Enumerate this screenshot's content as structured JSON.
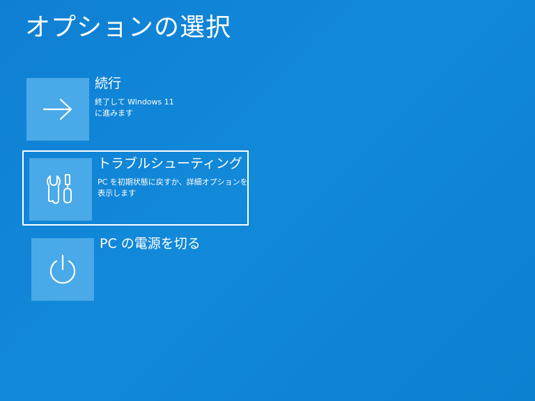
{
  "page": {
    "title": "オプションの選択"
  },
  "options": [
    {
      "title": "続行",
      "description": "終了して Windows 11 に進みます",
      "icon": "arrow-right-icon"
    },
    {
      "title": "トラブルシューティング",
      "description": "PC を初期状態に戻すか、詳細オプションを表示します",
      "icon": "tools-icon",
      "selected": true
    },
    {
      "title": "PC の電源を切る",
      "description": "",
      "icon": "power-icon"
    }
  ],
  "colors": {
    "background": "#1289d9",
    "tile": "#4aa9e8",
    "text": "#ffffff"
  }
}
